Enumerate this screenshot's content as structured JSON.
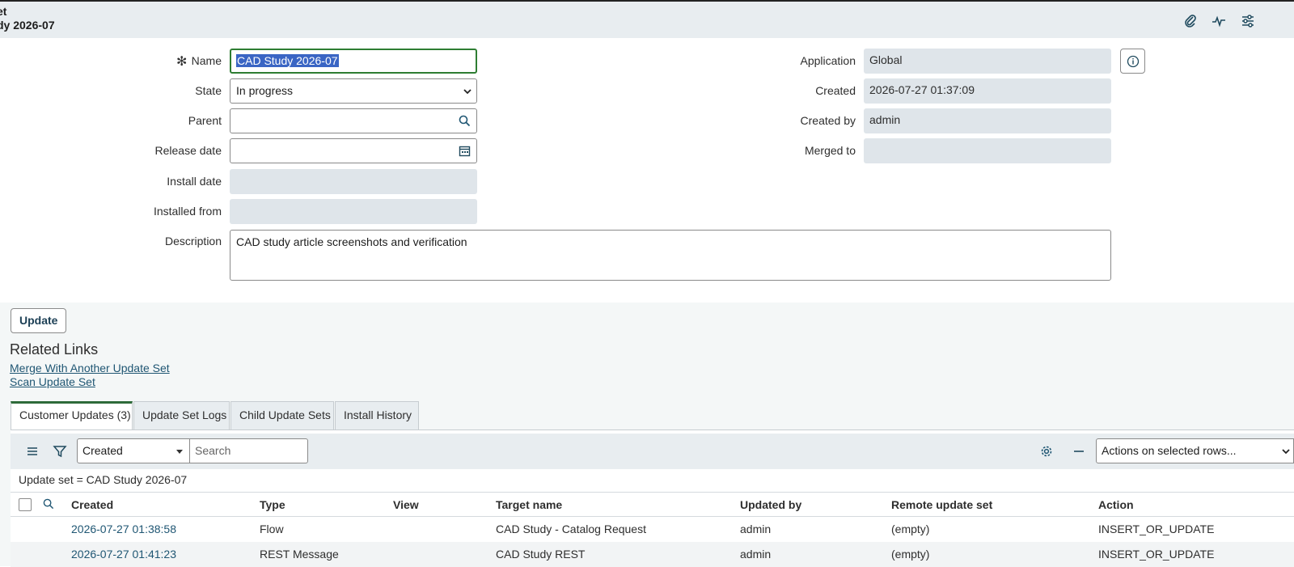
{
  "header": {
    "title_line1": "et",
    "title_line2": "dy 2026-07",
    "icons": [
      "paperclip-icon",
      "activity-icon",
      "settings-sliders-icon"
    ]
  },
  "form": {
    "name": {
      "label": "Name",
      "value": "CAD Study 2026-07"
    },
    "state": {
      "label": "State",
      "value": "In progress"
    },
    "parent": {
      "label": "Parent",
      "value": ""
    },
    "release_date": {
      "label": "Release date",
      "value": ""
    },
    "install_date": {
      "label": "Install date",
      "value": ""
    },
    "installed_from": {
      "label": "Installed from",
      "value": ""
    },
    "description": {
      "label": "Description",
      "value": "CAD study article screenshots and verification"
    },
    "application": {
      "label": "Application",
      "value": "Global"
    },
    "created": {
      "label": "Created",
      "value": "2026-07-27 01:37:09"
    },
    "created_by": {
      "label": "Created by",
      "value": "admin"
    },
    "merged_to": {
      "label": "Merged to",
      "value": ""
    }
  },
  "actions": {
    "update_label": "Update"
  },
  "related_links": {
    "title": "Related Links",
    "links": [
      "Merge With Another Update Set",
      "Scan Update Set"
    ]
  },
  "tabs": [
    "Customer Updates (3)",
    "Update Set Logs",
    "Child Update Sets",
    "Install History"
  ],
  "list": {
    "filter_field": "Created",
    "search_placeholder": "Search",
    "actions_dropdown": "Actions on selected rows...",
    "breadcrumb": "Update set = CAD Study 2026-07",
    "columns": [
      "Created",
      "Type",
      "View",
      "Target name",
      "Updated by",
      "Remote update set",
      "Action"
    ],
    "rows": [
      [
        "2026-07-27 01:38:58",
        "Flow",
        "",
        "CAD Study - Catalog Request",
        "admin",
        "(empty)",
        "INSERT_OR_UPDATE"
      ],
      [
        "2026-07-27 01:41:23",
        "REST Message",
        "",
        "CAD Study REST",
        "admin",
        "(empty)",
        "INSERT_OR_UPDATE"
      ]
    ]
  },
  "colors": {
    "header_bg": "#e8edf0",
    "readonly_bg": "#dfe5ea",
    "focus_border": "#2e7d32",
    "link": "#1f5673",
    "active_tab": "#2e6b3a"
  }
}
